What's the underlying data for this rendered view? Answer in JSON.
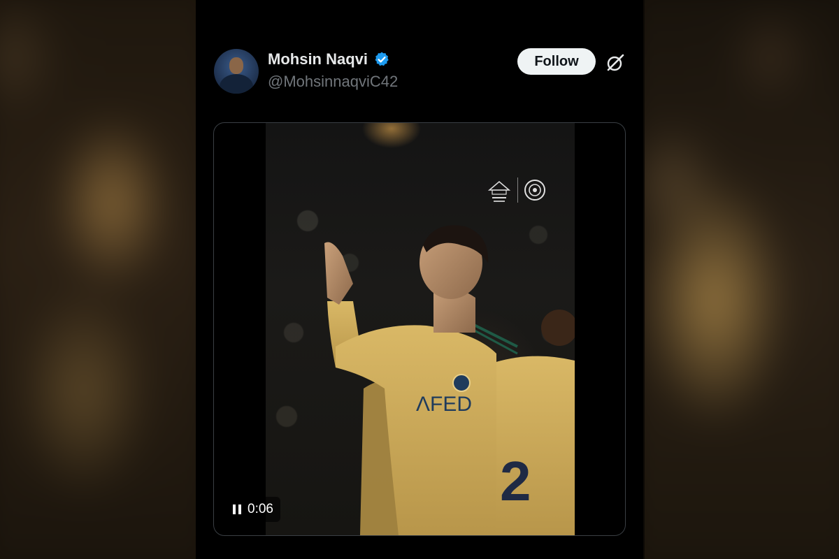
{
  "tweet": {
    "author": {
      "display_name": "Mohsin Naqvi",
      "handle": "@MohsinnaqviC42",
      "verified": true,
      "avatar_icon": "avatar-photo"
    },
    "follow_button_label": "Follow",
    "media": {
      "type": "video",
      "state": "playing",
      "elapsed_time": "0:06",
      "controls": {
        "pause_icon": "pause-icon"
      }
    }
  },
  "colors": {
    "background": "#000000",
    "name_text": "#e7e9ea",
    "secondary_text": "#71767b",
    "verified_blue": "#1d9bf0",
    "follow_button_bg": "#eff3f4",
    "follow_button_text": "#0f1419",
    "media_border": "#3a3f44",
    "jersey_yellow": "#d8b760"
  }
}
